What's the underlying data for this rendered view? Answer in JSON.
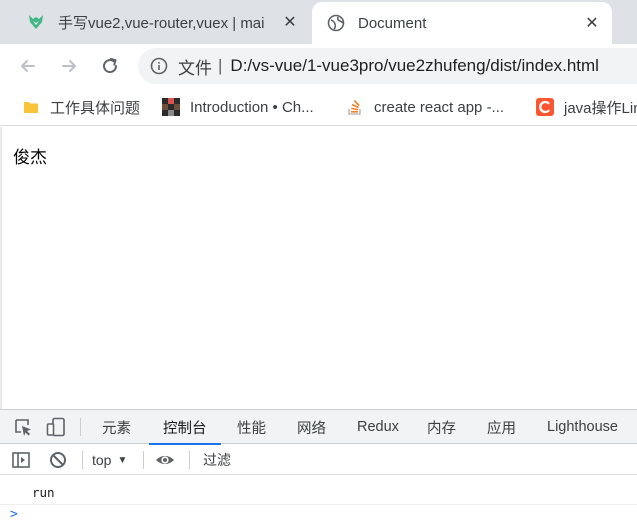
{
  "tabs": [
    {
      "title": "手写vue2,vue-router,vuex | mai",
      "favicon": "vue-fox-icon",
      "active": false
    },
    {
      "title": "Document",
      "favicon": "globe-icon",
      "active": true
    }
  ],
  "toolbar": {
    "scheme_label": "文件",
    "separator": "|",
    "url": "D:/vs-vue/1-vue3pro/vue2zhufeng/dist/index.html"
  },
  "bookmarks": [
    {
      "label": "工作具体问题",
      "icon": "folder-icon"
    },
    {
      "label": "Introduction • Ch...",
      "icon": "pixel-logo-icon"
    },
    {
      "label": "create react app -...",
      "icon": "stackoverflow-icon"
    },
    {
      "label": "java操作Linux",
      "icon": "csdn-icon"
    }
  ],
  "page": {
    "text": "俊杰"
  },
  "devtools": {
    "tabs": [
      "元素",
      "控制台",
      "性能",
      "网络",
      "Redux",
      "内存",
      "应用",
      "Lighthouse"
    ],
    "selected_tab": "控制台",
    "context": "top",
    "filter_placeholder": "过滤",
    "log": "run",
    "prompt": ">"
  },
  "colors": {
    "accent": "#1a73e8",
    "tabstrip": "#dee1e6",
    "omnibox": "#f1f3f4"
  }
}
